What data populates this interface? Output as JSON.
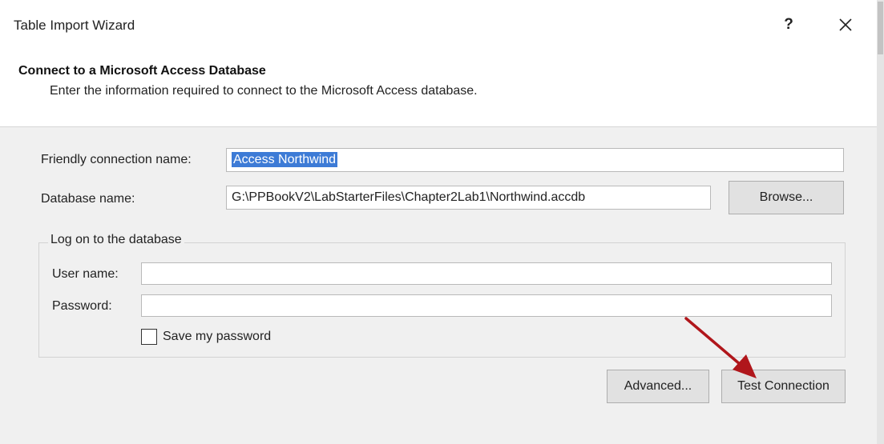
{
  "window": {
    "title": "Table Import Wizard",
    "help_label": "?"
  },
  "header": {
    "title": "Connect to a Microsoft Access Database",
    "description": "Enter the information required to connect to the Microsoft Access database."
  },
  "form": {
    "friendly_name_label": "Friendly connection name:",
    "friendly_name_value": "Access Northwind",
    "database_name_label": "Database name:",
    "database_name_value": "G:\\PPBookV2\\LabStarterFiles\\Chapter2Lab1\\Northwind.accdb",
    "browse_label": "Browse..."
  },
  "logon": {
    "group_label": "Log on to the database",
    "username_label": "User name:",
    "username_value": "",
    "password_label": "Password:",
    "password_value": "",
    "save_password_label": "Save my password",
    "save_password_checked": false
  },
  "buttons": {
    "advanced_label": "Advanced...",
    "test_connection_label": "Test Connection"
  },
  "colors": {
    "annotation_arrow": "#b0161b",
    "selection": "#3d7bd6"
  },
  "icons": {
    "close": "close-icon",
    "annotation": "arrow-annotation-icon"
  }
}
